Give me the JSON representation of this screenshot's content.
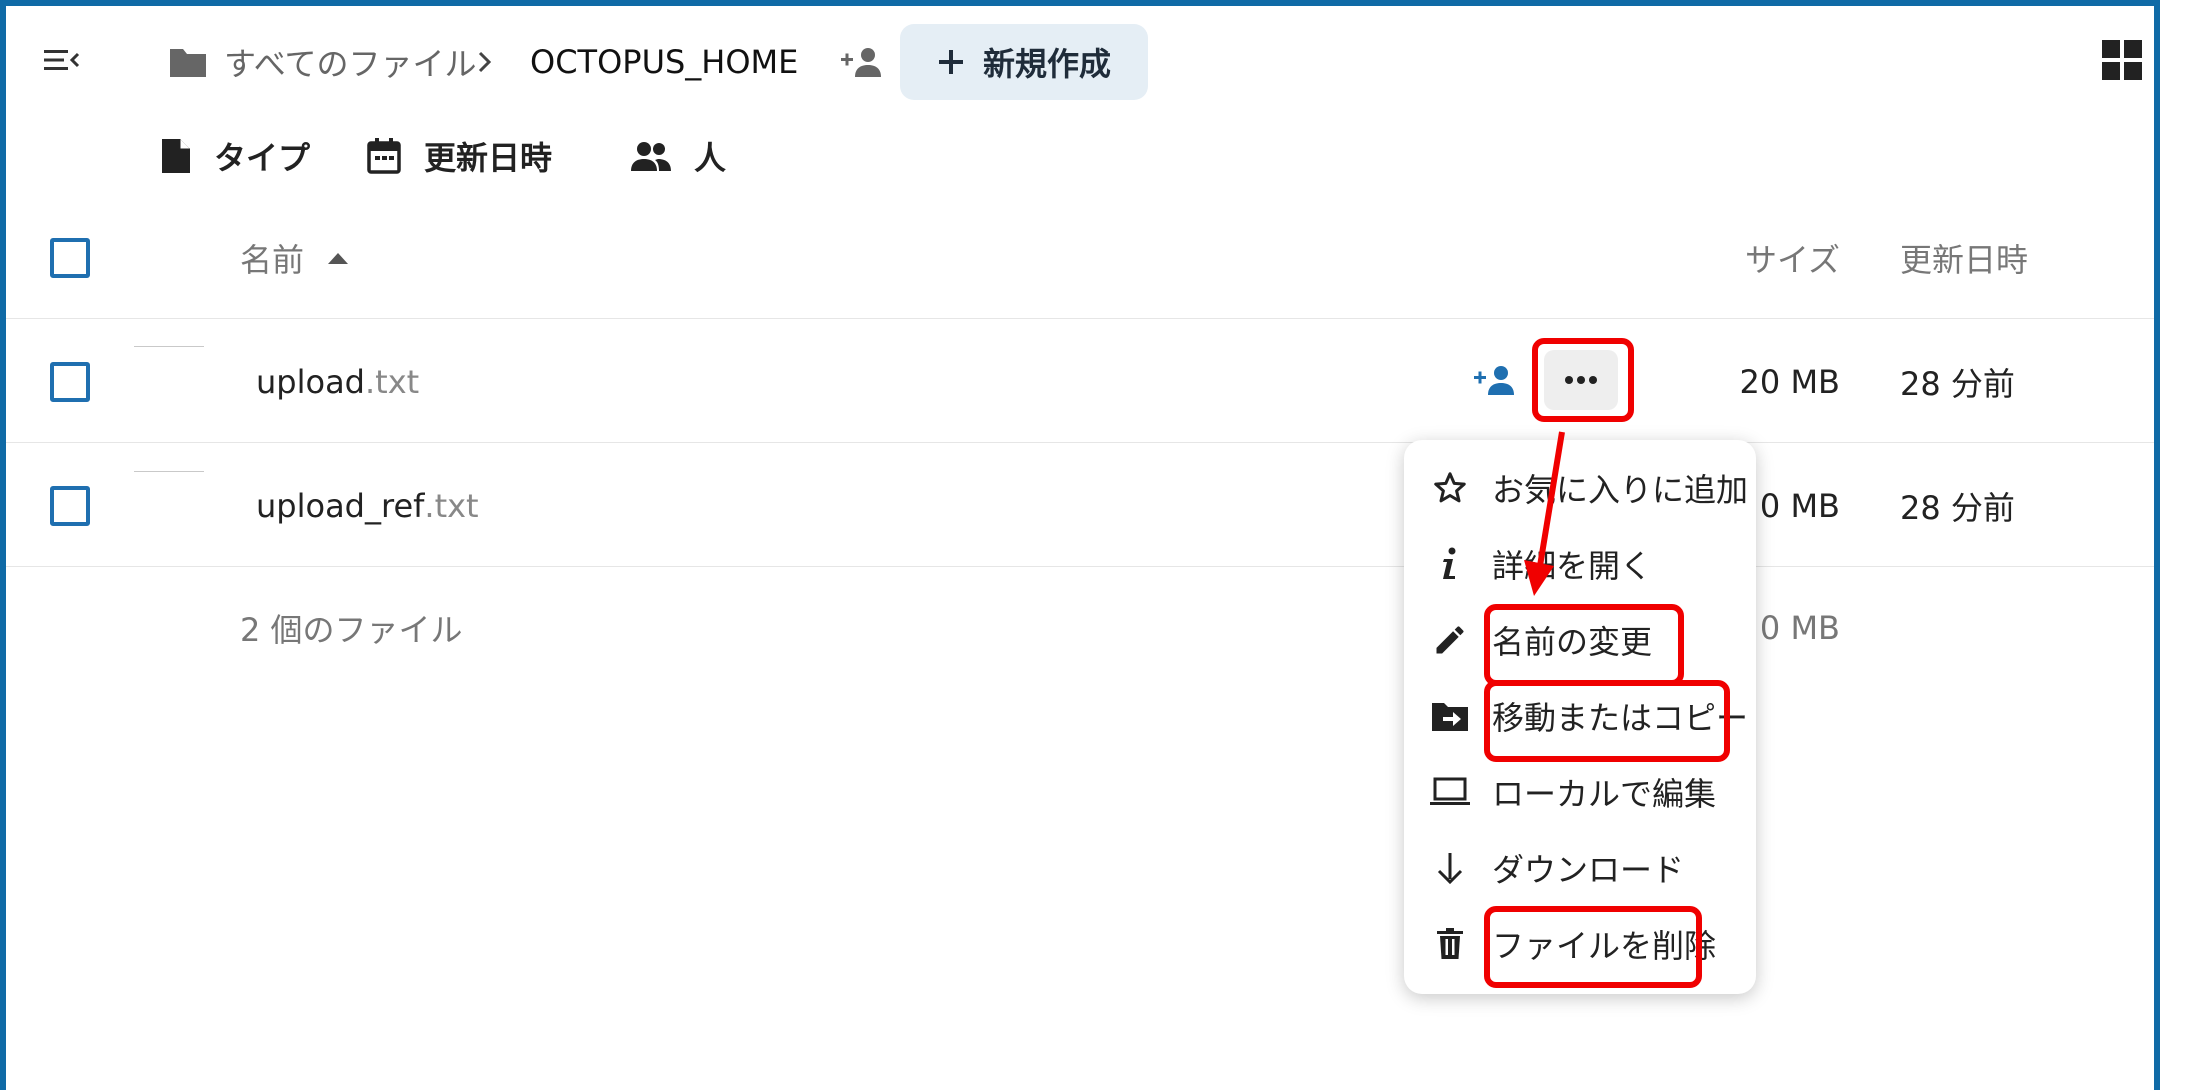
{
  "colors": {
    "accent": "#1f6fb0",
    "frame": "#0f6aa6",
    "new_button_bg": "#e5eef5",
    "annotation": "#f00000"
  },
  "header": {
    "toggle_icon": "menu-collapse-icon",
    "breadcrumb_root": "すべてのファイル",
    "breadcrumb_root_icon": "folder-icon",
    "breadcrumb_current": "OCTOPUS_HOME",
    "share_icon": "account-plus-icon",
    "new_button_label": "新規作成",
    "new_button_icon": "plus-icon",
    "view_toggle_icon": "grid-view-icon"
  },
  "filters": [
    {
      "label": "タイプ",
      "icon": "file-icon"
    },
    {
      "label": "更新日時",
      "icon": "calendar-icon"
    },
    {
      "label": "人",
      "icon": "people-icon"
    }
  ],
  "table": {
    "columns": {
      "name": "名前",
      "size": "サイズ",
      "modified": "更新日時"
    },
    "sort": {
      "column": "name",
      "direction": "ascending",
      "icon": "sort-up-icon"
    },
    "rows": [
      {
        "basename": "upload",
        "ext": ".txt",
        "size": "20 MB",
        "modified": "28 分前"
      },
      {
        "basename": "upload_ref",
        "ext": ".txt",
        "size": "0 MB",
        "modified": "28 分前"
      }
    ],
    "summary": {
      "count": "2 個のファイル",
      "size": "0 MB"
    }
  },
  "context_menu": {
    "items": [
      {
        "label": "お気に入りに追加",
        "icon": "star-outline-icon"
      },
      {
        "label": "詳細を開く",
        "icon": "information-icon"
      },
      {
        "label": "名前の変更",
        "icon": "pencil-icon",
        "highlighted": true
      },
      {
        "label": "移動またはコピー",
        "icon": "folder-move-icon",
        "highlighted": true
      },
      {
        "label": "ローカルで編集",
        "icon": "laptop-icon"
      },
      {
        "label": "ダウンロード",
        "icon": "download-arrow-icon"
      },
      {
        "label": "ファイルを削除",
        "icon": "trash-icon",
        "highlighted": true
      }
    ]
  }
}
